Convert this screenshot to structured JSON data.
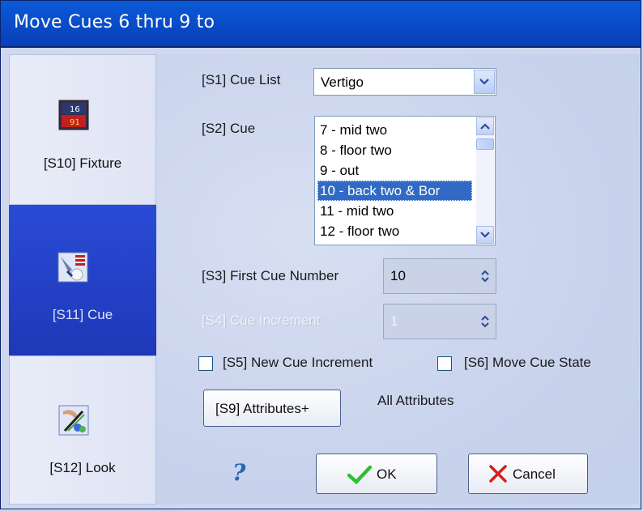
{
  "window": {
    "title": "Move Cues 6 thru 9 to"
  },
  "sidebar": {
    "items": [
      {
        "label": "[S10] Fixture",
        "icon": "fixture-icon",
        "active": false
      },
      {
        "label": "[S11] Cue",
        "icon": "cue-icon",
        "active": true
      },
      {
        "label": "[S12] Look",
        "icon": "look-icon",
        "active": false
      }
    ]
  },
  "form": {
    "cue_list": {
      "label": "[S1] Cue List",
      "value": "Vertigo"
    },
    "cue": {
      "label": "[S2] Cue",
      "items": [
        "7 - mid two",
        "8 - floor two",
        "9 - out",
        "10 - back two & Bor",
        "11 - mid two",
        "12 - floor two"
      ],
      "selected_index": 3
    },
    "first_cue_number": {
      "label": "[S3] First Cue Number",
      "value": "10"
    },
    "cue_increment": {
      "label": "[S4] Cue Increment",
      "value": "1",
      "disabled": true
    },
    "new_cue_increment": {
      "label": "[S5] New Cue Increment",
      "checked": false
    },
    "move_cue_state": {
      "label": "[S6] Move Cue State",
      "checked": false
    },
    "attributes_button": {
      "label": "[S9] Attributes+"
    },
    "attributes_value": "All Attributes"
  },
  "footer": {
    "help": "?",
    "ok_label": "OK",
    "cancel_label": "Cancel"
  },
  "colors": {
    "title_bar": "#0a4fcb",
    "selection": "#316ac5",
    "sidebar_active": "#2a4bd6",
    "ok_check": "#2fbf2f",
    "cancel_x": "#d42020"
  }
}
